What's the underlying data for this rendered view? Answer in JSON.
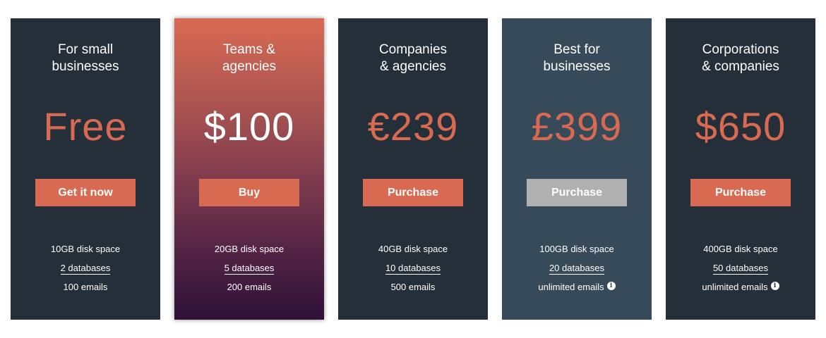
{
  "plans": [
    {
      "title": "For small\nbusinesses",
      "price": "Free",
      "button": "Get it now",
      "button_disabled": false,
      "features": [
        "10GB disk space",
        "2 databases",
        "100 emails"
      ],
      "info_icon": false
    },
    {
      "title": "Teams &\nagencies",
      "price": "$100",
      "button": "Buy",
      "button_disabled": false,
      "features": [
        "20GB disk space",
        "5 databases",
        "200 emails"
      ],
      "info_icon": false
    },
    {
      "title": "Companies\n& agencies",
      "price": "€239",
      "button": "Purchase",
      "button_disabled": false,
      "features": [
        "40GB disk space",
        "10 databases",
        "500 emails"
      ],
      "info_icon": false
    },
    {
      "title": "Best for\nbusinesses",
      "price": "£399",
      "button": "Purchase",
      "button_disabled": true,
      "features": [
        "100GB disk space",
        "20 databases",
        "unlimited emails"
      ],
      "info_icon": true
    },
    {
      "title": "Corporations\n& companies",
      "price": "$650",
      "button": "Purchase",
      "button_disabled": false,
      "features": [
        "400GB disk space",
        "50 databases",
        "unlimited emails"
      ],
      "info_icon": true
    }
  ],
  "icons": {
    "info": "info-icon",
    "info_glyph": "i"
  },
  "colors": {
    "card_dark": "#252f39",
    "card_highlight": "#364a5a",
    "accent": "#d96a52",
    "button_disabled": "#b0b0b0"
  }
}
